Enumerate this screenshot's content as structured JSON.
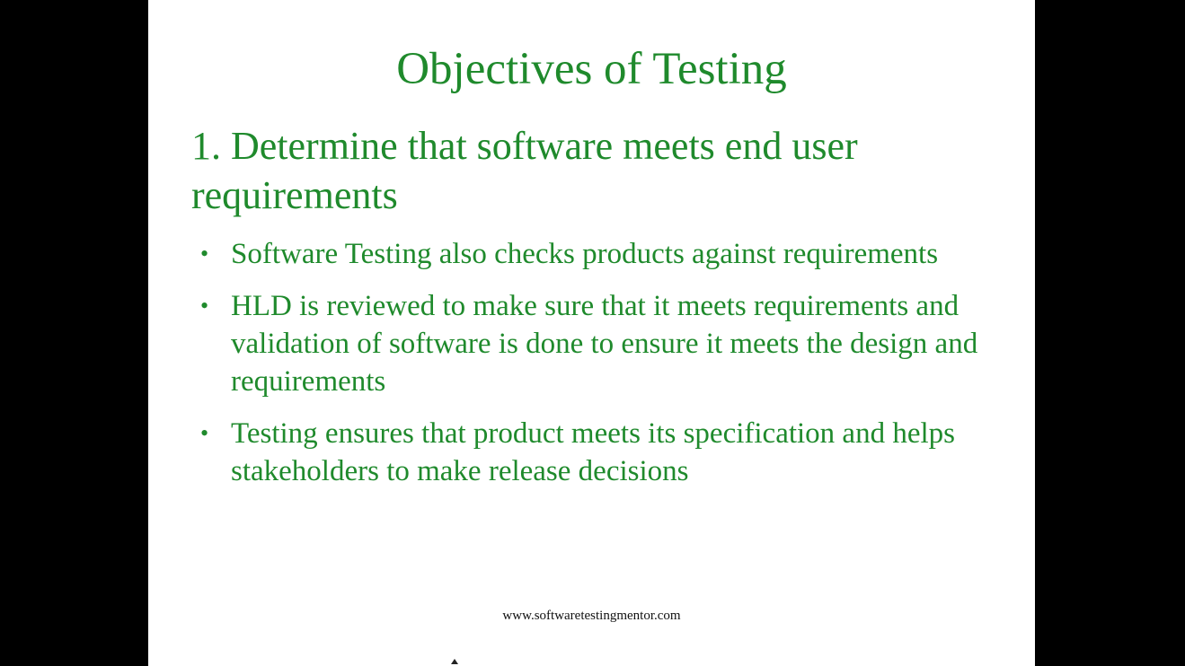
{
  "slide": {
    "title": "Objectives of Testing",
    "heading": "1. Determine that software meets end user requirements",
    "bullet_glyph": "•",
    "bullets": [
      "Software Testing also checks products against requirements",
      "HLD is reviewed to make sure that it meets requirements and validation of software is done to ensure it meets the design and requirements",
      "Testing ensures that product meets its specification and helps stakeholders to make release decisions"
    ],
    "footer": "www.softwaretestingmentor.com"
  },
  "colors": {
    "text_green": "#1f8a2c",
    "background": "#ffffff",
    "letterbox": "#000000"
  },
  "icons": {
    "bullet": "bullet-dot-icon"
  }
}
